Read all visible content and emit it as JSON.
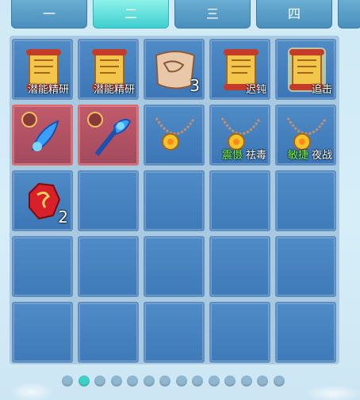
{
  "tabs": [
    {
      "label": "一",
      "active": false
    },
    {
      "label": "二",
      "active": true
    },
    {
      "label": "三",
      "active": false
    },
    {
      "label": "四",
      "active": false
    }
  ],
  "inventory": {
    "items": [
      {
        "icon": "gold-scroll-icon",
        "label": "潜能精研"
      },
      {
        "icon": "gold-scroll-icon",
        "label": "潜能精研"
      },
      {
        "icon": "map-scroll-icon",
        "count": "3"
      },
      {
        "icon": "gold-scroll-icon",
        "label": "迟钝"
      },
      {
        "icon": "gold-scroll-icon-glow",
        "label": "追击"
      },
      {
        "icon": "blue-feather-ornament-icon"
      },
      {
        "icon": "blue-wand-ornament-icon"
      },
      {
        "icon": "gold-pendant-necklace-icon"
      },
      {
        "icon": "gold-pendant-necklace-icon",
        "tag": "震慑",
        "label": "祛毒"
      },
      {
        "icon": "gold-pendant-necklace-icon",
        "tag": "敏捷",
        "label": "夜战"
      },
      {
        "icon": "red-gem-icon",
        "count": "2"
      }
    ]
  },
  "pagination": {
    "pages": 14,
    "current": 2
  },
  "colors": {
    "accent": "#3fd0c8",
    "slot": "#4f8bc6",
    "slot_border": "#5e8fc0",
    "tag_green": "#7cff4a"
  }
}
